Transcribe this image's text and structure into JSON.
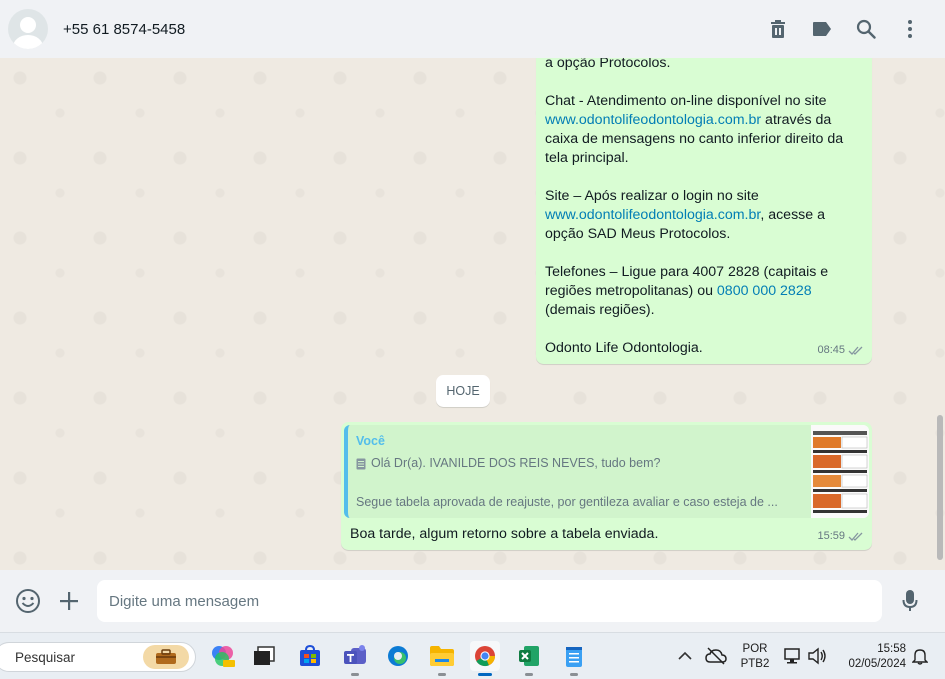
{
  "header": {
    "contact": "+55 61 8574-5458",
    "icons": [
      "trash-icon",
      "label-icon",
      "search-icon",
      "menu-icon"
    ]
  },
  "messages": [
    {
      "direction": "outgoing",
      "lines": {
        "top": "a opção Protocolos.",
        "chat_a": "Chat - Atendimento on-line disponível no site",
        "chat_link": "www.odontolifeodontologia.com.br",
        "chat_b": " através da caixa de mensagens no canto inferior direito da tela principal.",
        "site_a": "Site – Após realizar o login no site",
        "site_link": "www.odontolifeodontologia.com.br",
        "site_b": ", acesse a opção SAD Meus Protocolos.",
        "tel_a": "Telefones – Ligue para 4007 2828 (capitais e regiões metropolitanas) ou ",
        "tel_link": "0800 000 2828",
        "tel_b": " (demais regiões).",
        "sign": "Odonto Life Odontologia."
      },
      "time": "08:45"
    },
    {
      "direction": "outgoing",
      "quote": {
        "author": "Você",
        "line1": "Olá Dr(a). IVANILDE DOS REIS NEVES, tudo bem?",
        "line2": "Segue tabela aprovada de reajuste, por gentileza avaliar e caso esteja de ..."
      },
      "text": "Boa tarde, algum retorno sobre a tabela enviada.",
      "time": "15:59"
    }
  ],
  "date_chip": "HOJE",
  "composer": {
    "placeholder": "Digite uma mensagem"
  },
  "taskbar": {
    "search": "Pesquisar",
    "lang": "POR",
    "layout": "PTB2",
    "time": "15:58",
    "date": "02/05/2024"
  },
  "colors": {
    "bubble_out": "#d9fdd3",
    "link": "#027eb5",
    "quote_accent": "#53bdeb",
    "background": "#efeae2"
  }
}
